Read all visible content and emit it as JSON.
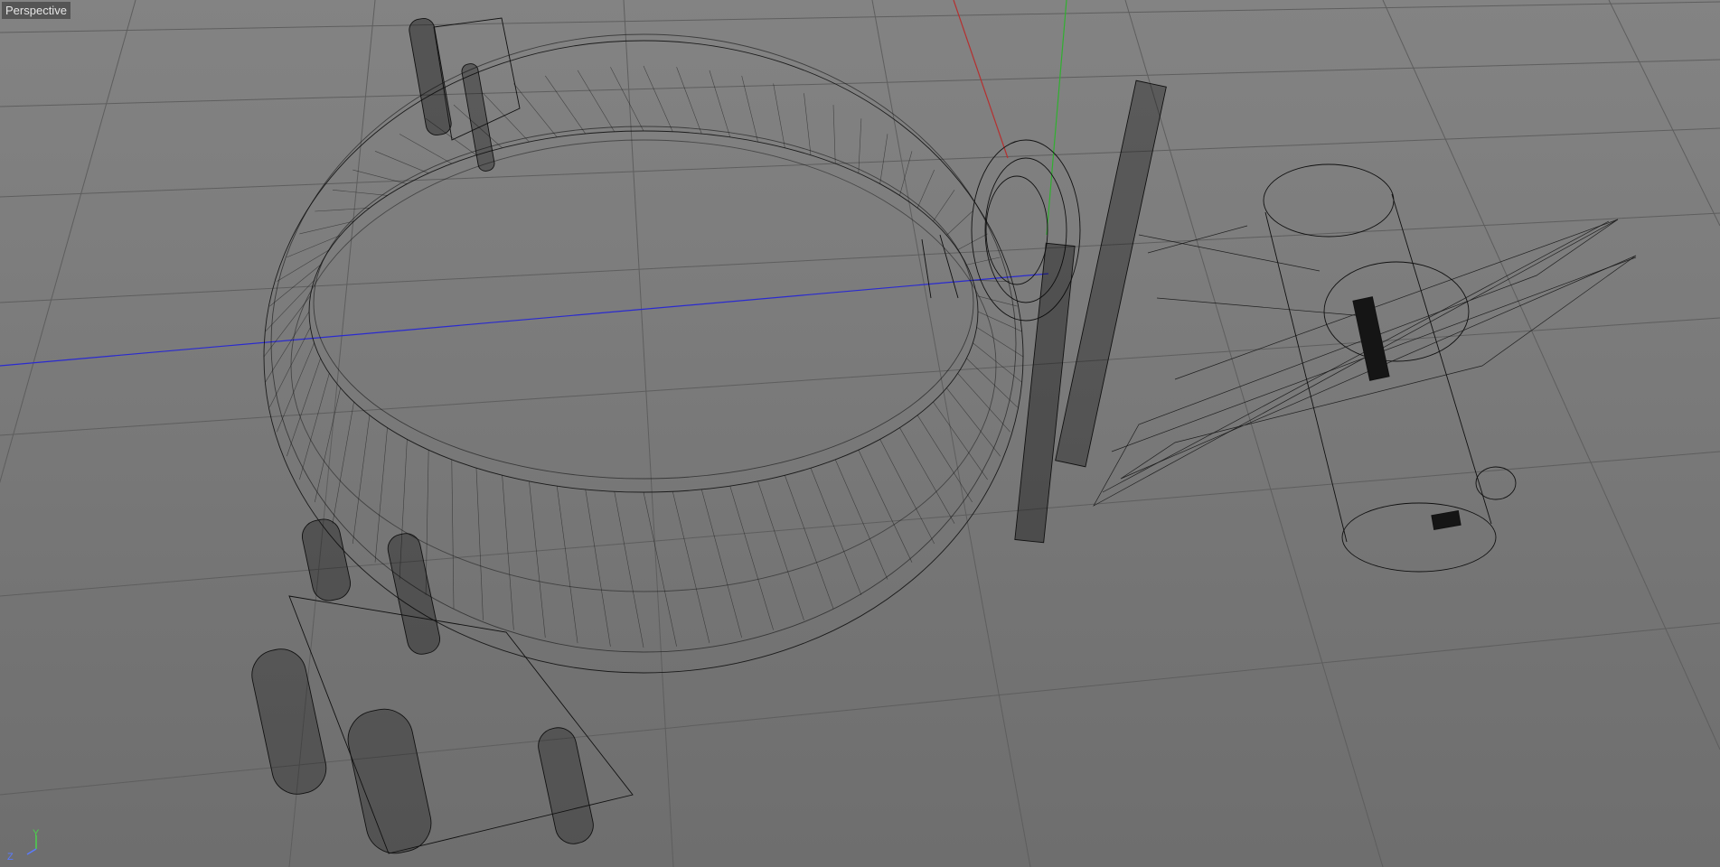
{
  "viewport": {
    "label": "Perspective"
  },
  "axis_gizmo": {
    "y_label": "Y",
    "z_label": "Z",
    "y_color": "#4bd24b",
    "z_color": "#5a7bff"
  },
  "scene": {
    "background_color": "#7a7a7a",
    "grid_color": "#5f5f5f",
    "wire_color": "#101010",
    "x_axis_color": "#c83232",
    "y_axis_color": "#32c832",
    "z_axis_color": "#3232c8",
    "object": "wireframe-mesh"
  }
}
